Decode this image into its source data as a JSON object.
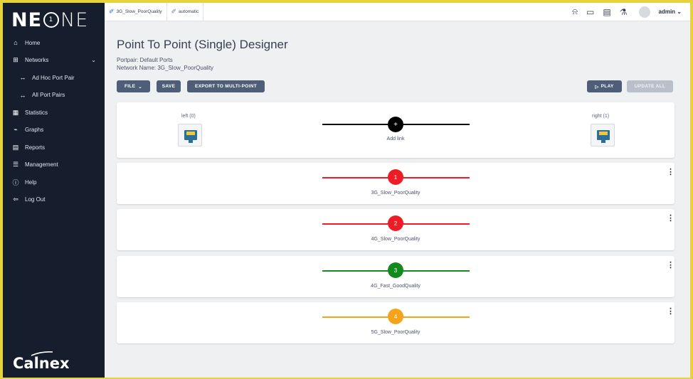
{
  "app": {
    "logo_ne": "NE",
    "logo_one_circle": "1",
    "logo_ne2": "NE",
    "brand": "Calnex"
  },
  "sidebar": {
    "items": [
      {
        "label": "Home",
        "icon": "home-icon",
        "glyph": "⌂"
      },
      {
        "label": "Networks",
        "icon": "network-icon",
        "glyph": "⊞"
      },
      {
        "label": "Ad Hoc Port Pair",
        "icon": "arrows-icon",
        "glyph": "↔"
      },
      {
        "label": "All Port Pairs",
        "icon": "arrows-icon",
        "glyph": "↔"
      },
      {
        "label": "Statistics",
        "icon": "table-icon",
        "glyph": "▦"
      },
      {
        "label": "Graphs",
        "icon": "chart-icon",
        "glyph": "⌁"
      },
      {
        "label": "Reports",
        "icon": "document-icon",
        "glyph": "▤"
      },
      {
        "label": "Management",
        "icon": "list-icon",
        "glyph": "☰"
      },
      {
        "label": "Help",
        "icon": "info-icon",
        "glyph": "ⓘ"
      },
      {
        "label": "Log Out",
        "icon": "logout-icon",
        "glyph": "⇦"
      }
    ],
    "networks_chevron": "⌄"
  },
  "topbar": {
    "crumbs": [
      "3G_Slow_PoorQuality",
      "automatic"
    ],
    "user": "admin",
    "user_chevron": "⌄"
  },
  "page": {
    "title": "Point To Point (Single) Designer",
    "portpair": "Portpair: Default Ports",
    "network_name": "Network Name: 3G_Slow_PoorQuality"
  },
  "toolbar": {
    "file": "FILE",
    "save": "SAVE",
    "export": "EXPORT TO MULTI-POINT",
    "play": "PLAY",
    "update_all": "UPDATE ALL"
  },
  "designer": {
    "left_label": "left (0)",
    "right_label": "right (1)",
    "add_link_symbol": "+",
    "add_link_label": "Add link"
  },
  "links": [
    {
      "number": "1",
      "name": "3G_Slow_PoorQuality",
      "color": "#ee1c25"
    },
    {
      "number": "2",
      "name": "4G_Slow_PoorQuality",
      "color": "#ee1c25"
    },
    {
      "number": "3",
      "name": "4G_Fast_GoodQuality",
      "color": "#138a1e"
    },
    {
      "number": "4",
      "name": "5G_Slow_PoorQuality",
      "color": "#f5a31a"
    }
  ],
  "colors": {
    "sidebar_bg": "#161d2d",
    "frame_border": "#e6d33c",
    "button_bg": "#4f5e78"
  }
}
